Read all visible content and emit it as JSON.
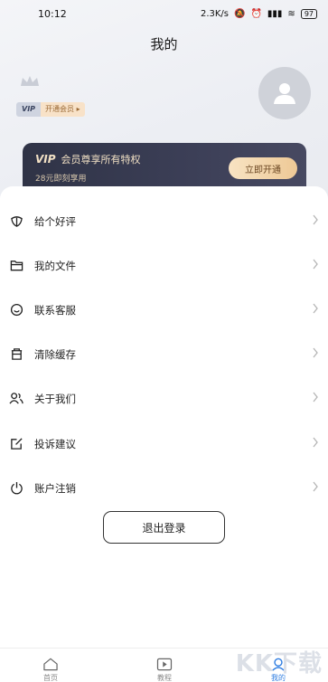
{
  "status_bar": {
    "time": "10:12",
    "speed": "2.3K/s",
    "battery": "97"
  },
  "header": {
    "title": "我的"
  },
  "profile": {
    "vip_badge": "VIP",
    "open_member": "开通会员"
  },
  "vip_card": {
    "vip_mark": "VIP",
    "title": "会员尊享所有特权",
    "subtitle": "28元即刻享用",
    "button": "立即开通"
  },
  "menu": [
    {
      "label": "给个好评",
      "icon": "flower-rate-icon"
    },
    {
      "label": "我的文件",
      "icon": "folder-icon"
    },
    {
      "label": "联系客服",
      "icon": "smile-chat-icon"
    },
    {
      "label": "清除缓存",
      "icon": "trash-bin-icon"
    },
    {
      "label": "关于我们",
      "icon": "users-icon"
    },
    {
      "label": "投诉建议",
      "icon": "edit-icon"
    },
    {
      "label": "账户注销",
      "icon": "power-icon"
    }
  ],
  "logout": "退出登录",
  "tabs": [
    {
      "label": "首页",
      "icon": "home-icon"
    },
    {
      "label": "教程",
      "icon": "video-icon"
    },
    {
      "label": "我的",
      "icon": "profile-icon"
    }
  ],
  "watermark": "KK下载",
  "colors": {
    "accent": "#2f7de1",
    "vip_dark": "#33364c",
    "gold": "#f1d2a4"
  }
}
